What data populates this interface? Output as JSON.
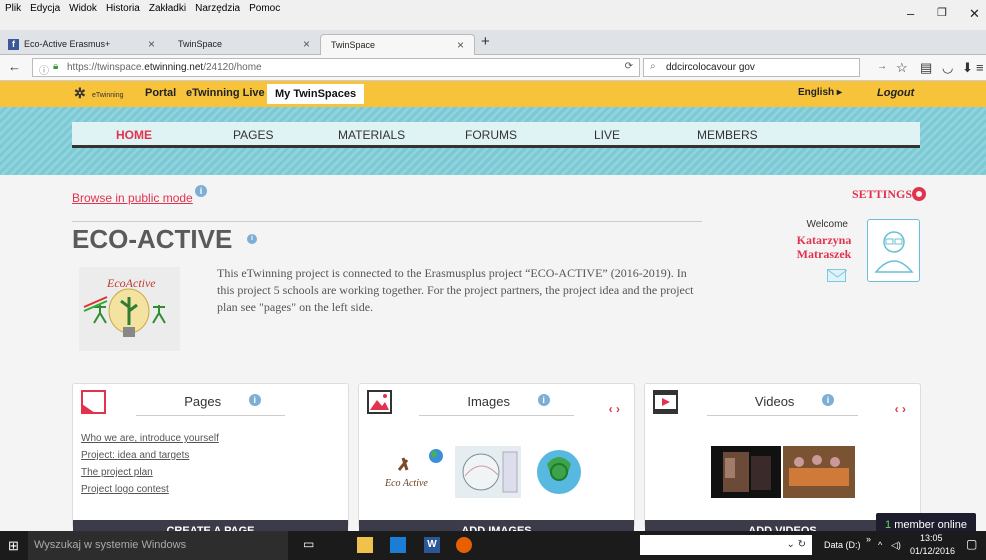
{
  "browser": {
    "menu": [
      "Plik",
      "Edycja",
      "Widok",
      "Historia",
      "Zakładki",
      "Narzędzia",
      "Pomoc"
    ],
    "tabs": [
      {
        "label": "Eco-Active Erasmus+"
      },
      {
        "label": "TwinSpace"
      },
      {
        "label": "TwinSpace"
      }
    ],
    "url_prefix": "https://twinspace.",
    "url_domain": "etwinning.net",
    "url_path": "/24120/home",
    "search_value": "ddcircolocavour gov"
  },
  "topbar": {
    "logo_text": "eTwinning",
    "portal": "Portal",
    "live": "eTwinning Live",
    "mytwinspaces": "My TwinSpaces",
    "language": "English ▸",
    "logout": "Logout"
  },
  "nav": {
    "items": [
      "HOME",
      "PAGES",
      "MATERIALS",
      "FORUMS",
      "LIVE",
      "MEMBERS"
    ]
  },
  "page": {
    "browse_public": "Browse in public mode",
    "settings": "SETTINGS",
    "title": "ECO-ACTIVE",
    "logo_text": "EcoActive",
    "description": "This eTwinning project is connected to the Erasmusplus project “ECO-ACTIVE” (2016-2019). In this project 5 schools are working together. For the project partners, the project idea and the project plan see \"pages\" on the left side.",
    "welcome": "Welcome",
    "user_name": "Katarzyna Matraszek"
  },
  "cards": {
    "pages": {
      "title": "Pages",
      "links": [
        "Who we are, introduce yourself",
        "Project: idea and targets",
        "The project plan",
        "Project logo contest"
      ],
      "button": "CREATE A PAGE"
    },
    "images": {
      "title": "Images",
      "arrows": "‹ ›",
      "button": "ADD IMAGES",
      "thumb_text": "Eco Active"
    },
    "videos": {
      "title": "Videos",
      "arrows": "‹ ›",
      "button": "ADD VIDEOS"
    }
  },
  "online": {
    "count": "1",
    "label": " member online"
  },
  "taskbar": {
    "search_placeholder": "Wyszukaj w systemie Windows",
    "drive": "Data (D:)",
    "time": "13:05",
    "date": "01/12/2016"
  },
  "colors": {
    "accent": "#e2334e",
    "topbar": "#f7c33a",
    "stripe": "#8fd3dd",
    "button": "#3b3b4a"
  }
}
